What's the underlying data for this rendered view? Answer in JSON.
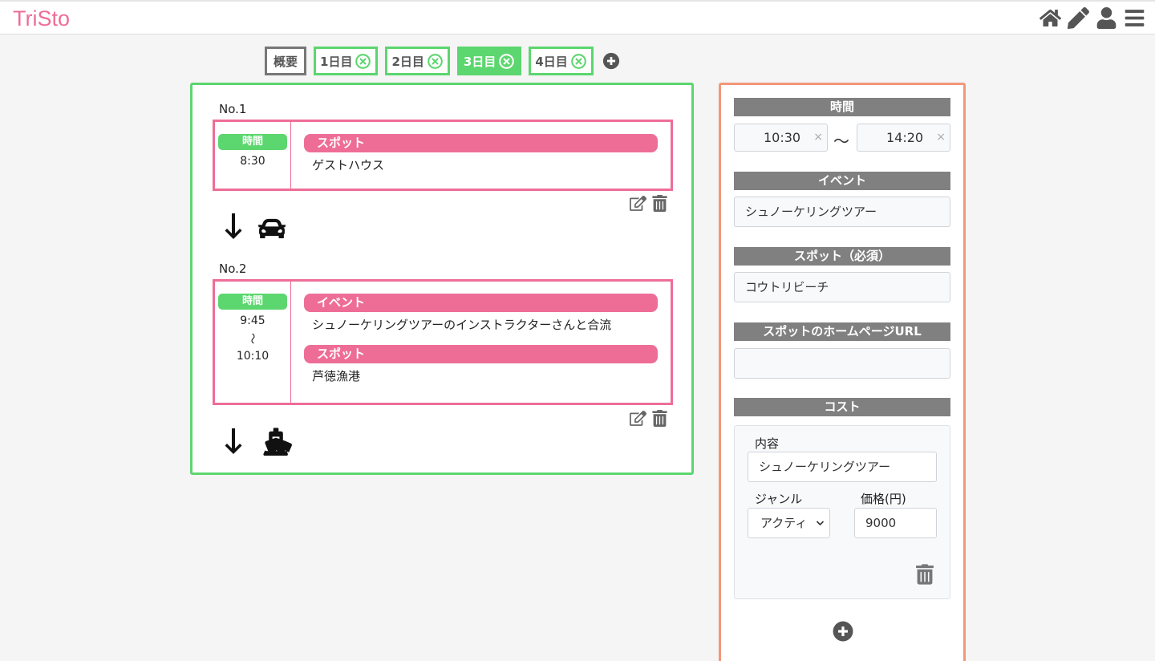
{
  "app": {
    "logo": "TriSto"
  },
  "header_icons": [
    "home-icon",
    "pencil-icon",
    "user-icon",
    "menu-icon"
  ],
  "tabs": [
    {
      "label": "概要",
      "type": "overview",
      "active": false
    },
    {
      "label": "1日目",
      "type": "day",
      "active": false
    },
    {
      "label": "2日目",
      "type": "day",
      "active": false
    },
    {
      "label": "3日目",
      "type": "day",
      "active": true
    },
    {
      "label": "4日目",
      "type": "day",
      "active": false
    }
  ],
  "schedule": {
    "items": [
      {
        "no": "No.1",
        "time_label": "時間",
        "time_start": "8:30",
        "spot_label": "スポット",
        "spot": "ゲストハウス",
        "transport": "car-icon"
      },
      {
        "no": "No.2",
        "time_label": "時間",
        "time_start": "9:45",
        "time_sep": "〜",
        "time_end": "10:10",
        "event_label": "イベント",
        "event": "シュノーケリングツアーのインストラクターさんと合流",
        "spot_label": "スポット",
        "spot": "芦徳漁港",
        "transport": "ship-icon"
      }
    ]
  },
  "editor": {
    "time_title": "時間",
    "time_start": "10:30",
    "time_end": "14:20",
    "time_sep": "〜",
    "clear_glyph": "×",
    "event_title": "イベント",
    "event_value": "シュノーケリングツアー",
    "spot_title": "スポット（必須）",
    "spot_value": "コウトリビーチ",
    "url_title": "スポットのホームページURL",
    "url_value": "",
    "cost_title": "コスト",
    "cost": {
      "content_label": "内容",
      "content_value": "シュノーケリングツアー",
      "genre_label": "ジャンル",
      "genre_value": "アクティ",
      "price_label": "価格(円)",
      "price_value": "9000"
    }
  },
  "colors": {
    "brand_pink": "#ee6d97",
    "green": "#5cd66e",
    "editor_border": "#f3977a",
    "section_gray": "#808080"
  }
}
